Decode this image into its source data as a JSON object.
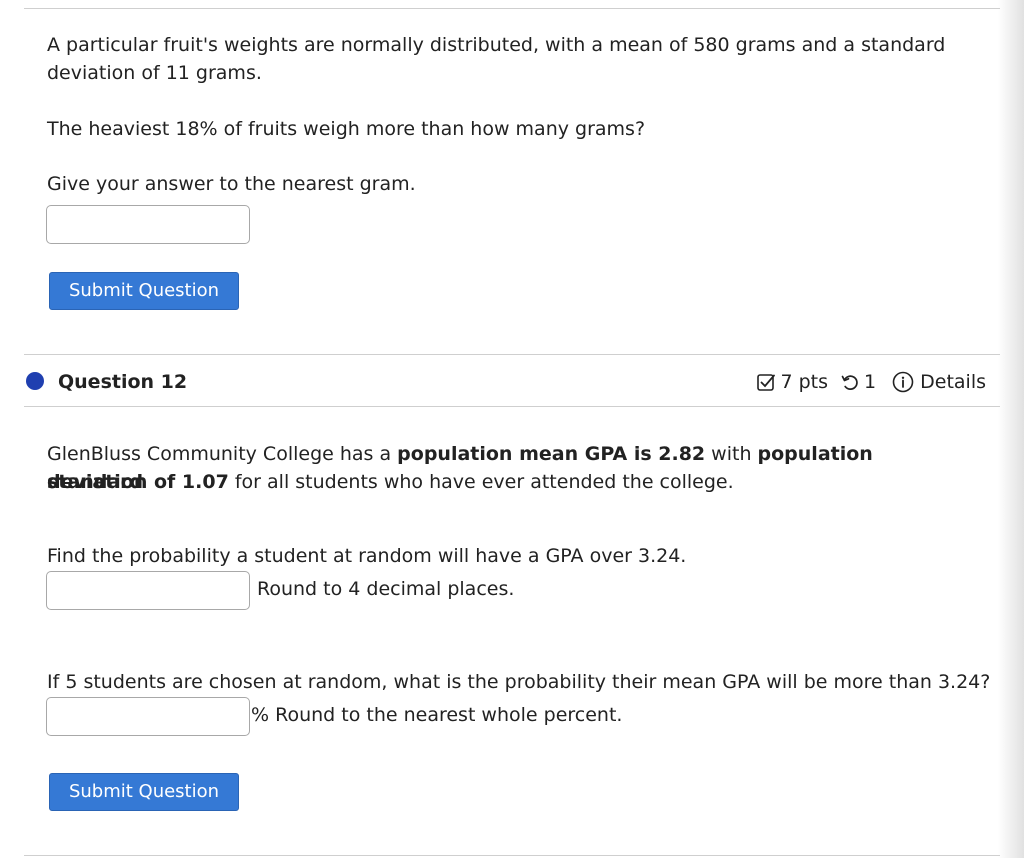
{
  "q11": {
    "stem_line1": "A particular fruit's weights are normally distributed, with a mean of 580 grams and a standard",
    "stem_line2": "deviation of 11 grams.",
    "question": "The heaviest 18% of fruits weigh more than how many grams?",
    "instruction": "Give your answer to the nearest gram.",
    "answer_value": "",
    "submit_label": "Submit Question"
  },
  "q12": {
    "title": "Question 12",
    "points": "7 pts",
    "attempts": "1",
    "details_label": "Details",
    "stem_a": "GlenBluss Community College has a ",
    "stem_b": "population mean GPA is 2.82",
    "stem_c": " with ",
    "stem_d": "population standard",
    "stem_e": "deviation of 1.07",
    "stem_f": " for all students who have ever attended the college.",
    "part1_prompt": "Find the probability a student at random will have a GPA over 3.24.",
    "part1_suffix": "Round to 4 decimal places.",
    "part1_value": "",
    "part2_prompt": "If 5 students are chosen at random, what is the probability their mean GPA will be more than 3.24?",
    "part2_suffix": "% Round to the nearest whole percent.",
    "part2_value": "",
    "submit_label": "Submit Question"
  },
  "colors": {
    "accent": "#3579d5",
    "question_dot": "#1f3fb0"
  }
}
